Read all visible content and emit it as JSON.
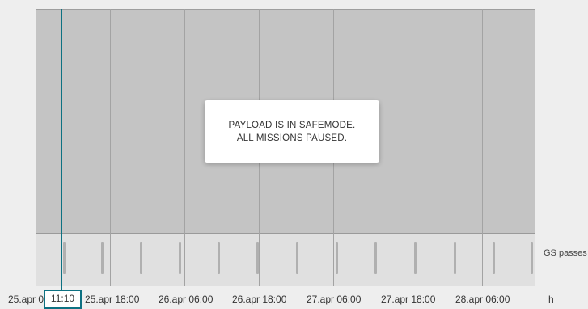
{
  "dialog": {
    "line1": "PAYLOAD IS IN SAFEMODE.",
    "line2": "ALL MISSIONS PAUSED."
  },
  "lanes": {
    "gs_passes_label": "GS passes"
  },
  "time_axis": {
    "ticks": [
      "25.apr 0",
      "25.apr 18:00",
      "26.apr 06:00",
      "26.apr 18:00",
      "27.apr 06:00",
      "27.apr 18:00",
      "28.apr 06:00",
      "h"
    ],
    "current_time": "11:10"
  },
  "colors": {
    "accent": "#0d7182",
    "mission_area": "#c4c4c4",
    "pass_lane": "#e0e0e0",
    "background": "#eeeeee"
  }
}
